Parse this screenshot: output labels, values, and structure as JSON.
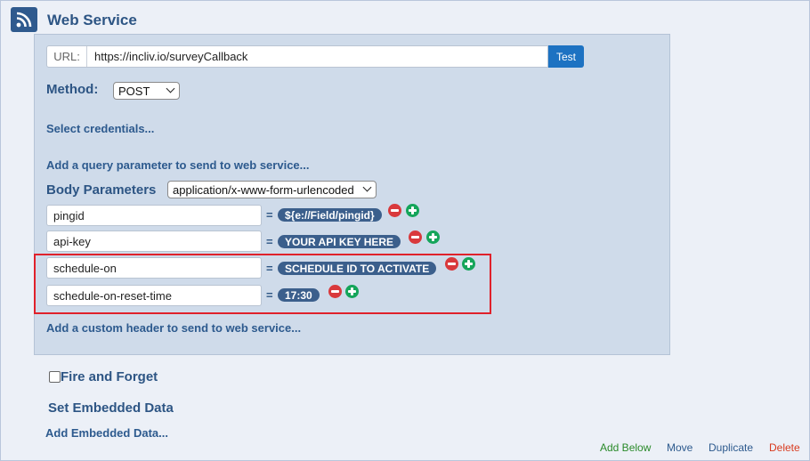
{
  "header": {
    "title": "Web Service",
    "icon": "rss-feed-icon"
  },
  "url": {
    "label": "URL:",
    "value": "https://incliv.io/surveyCallback",
    "test_label": "Test"
  },
  "method": {
    "label": "Method:",
    "selected": "POST"
  },
  "links": {
    "select_credentials": "Select credentials...",
    "add_query_param": "Add a query parameter to send to web service...",
    "add_custom_header": "Add a custom header to send to web service...",
    "add_embedded_data": "Add Embedded Data..."
  },
  "body_params": {
    "label": "Body Parameters",
    "encoding": "application/x-www-form-urlencoded",
    "rows": [
      {
        "key": "pingid",
        "value": "${e://Field/pingid}"
      },
      {
        "key": "api-key",
        "value": "YOUR API KEY HERE"
      },
      {
        "key": "schedule-on",
        "value": "SCHEDULE ID TO ACTIVATE"
      },
      {
        "key": "schedule-on-reset-time",
        "value": "17:30"
      }
    ],
    "equals": "="
  },
  "fire_and_forget": {
    "label": "Fire and Forget",
    "checked": false
  },
  "embedded_data": {
    "label": "Set Embedded Data"
  },
  "footer": {
    "add_below": "Add Below",
    "move": "Move",
    "duplicate": "Duplicate",
    "delete": "Delete"
  },
  "colors": {
    "accent": "#2d5584",
    "pill_bg": "#3b5f8c",
    "test_button": "#1d72c2",
    "remove": "#d9393c",
    "add": "#15a55a",
    "highlight": "#e0212b",
    "add_below": "#2a8a2a",
    "move": "#2d5a8e",
    "delete": "#d83a1e"
  }
}
